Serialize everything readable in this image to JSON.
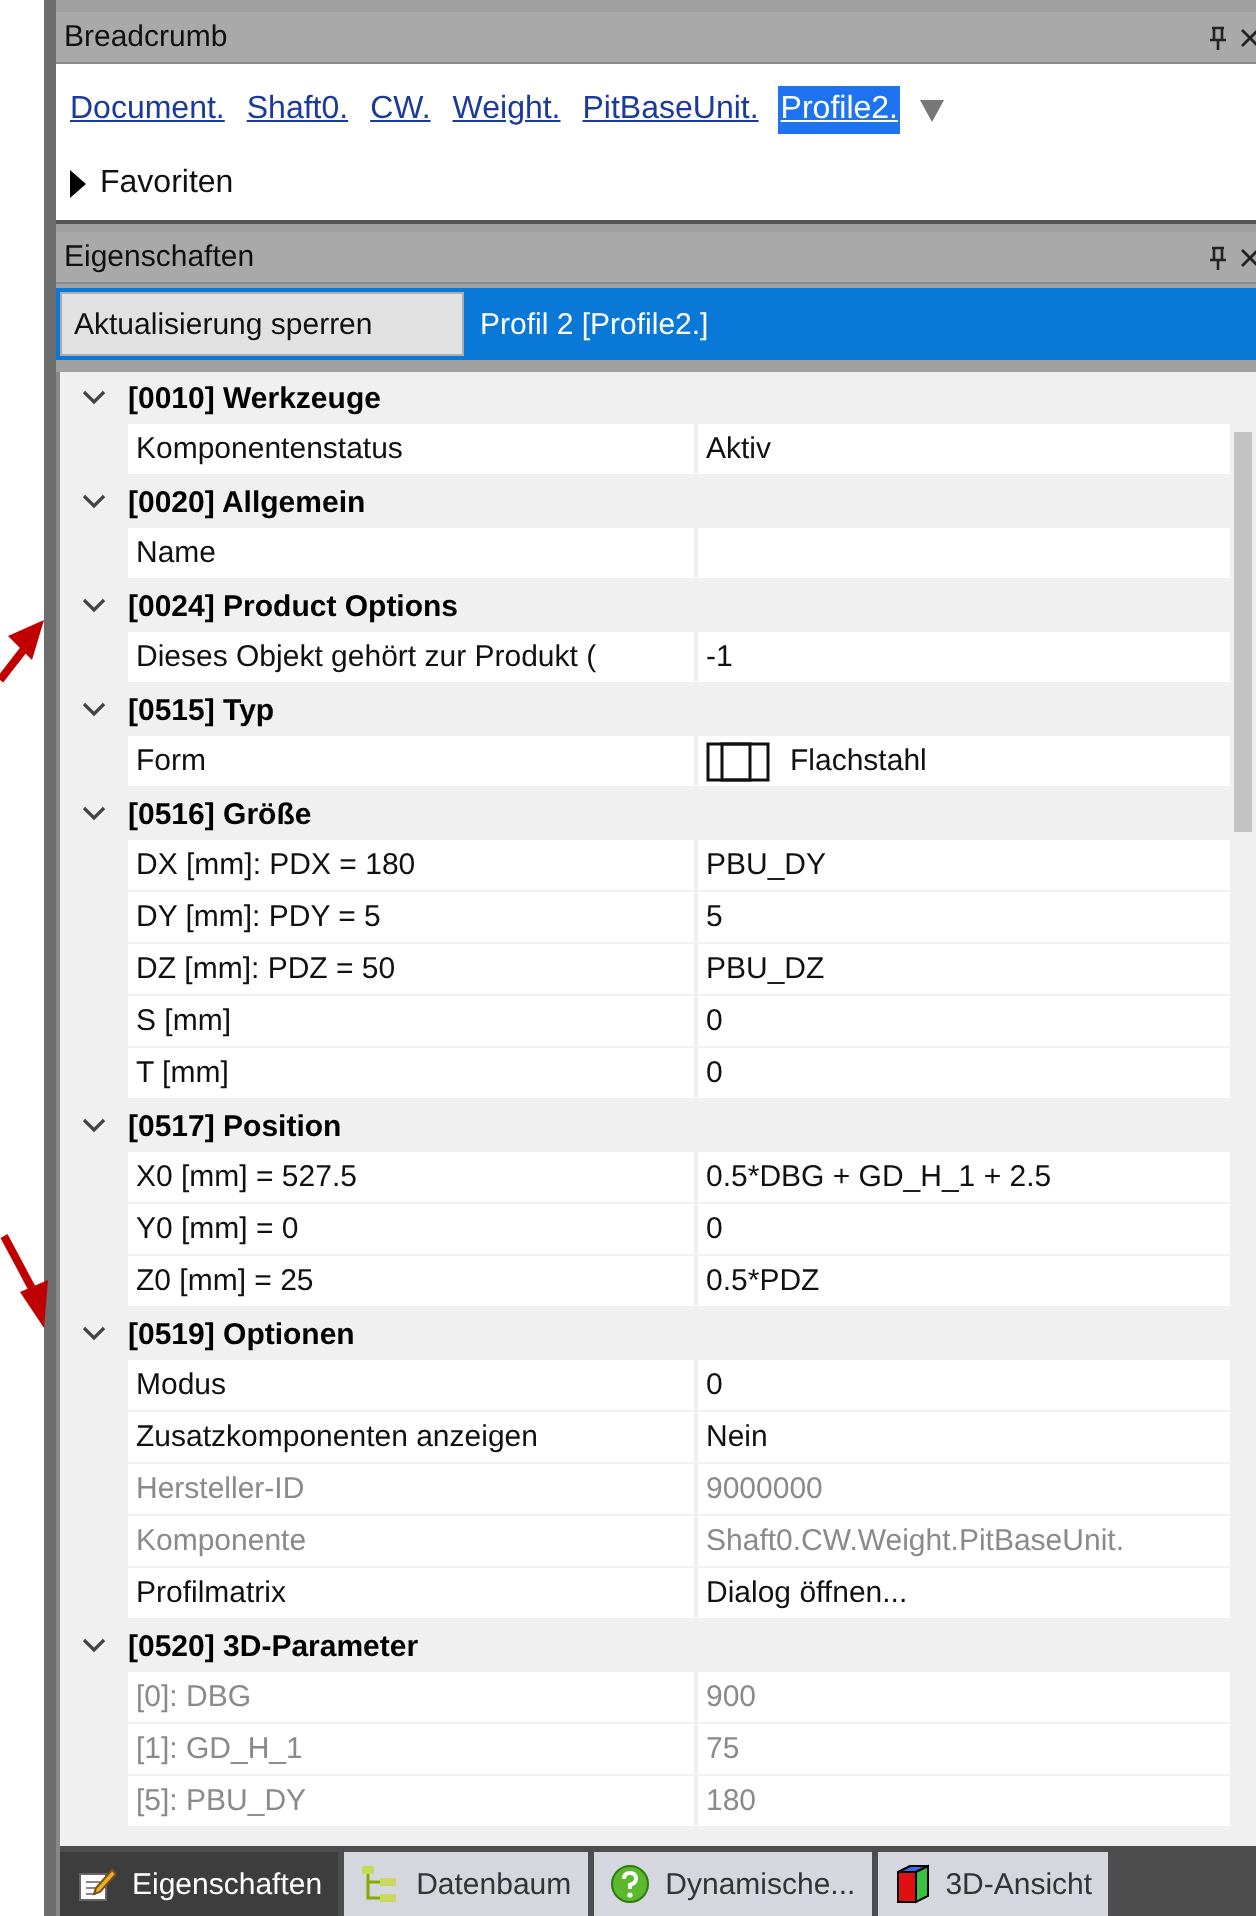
{
  "breadcrumb_panel": {
    "title": "Breadcrumb",
    "path": [
      {
        "label": "Document.",
        "selected": false
      },
      {
        "label": "Shaft0.",
        "selected": false
      },
      {
        "label": "CW.",
        "selected": false
      },
      {
        "label": "Weight.",
        "selected": false
      },
      {
        "label": "PitBaseUnit.",
        "selected": false
      },
      {
        "label": "Profile2.",
        "selected": true
      }
    ],
    "favorites": {
      "label": "Favoriten",
      "expanded": false
    }
  },
  "properties_panel": {
    "title": "Eigenschaften",
    "lock_button": "Aktualisierung sperren",
    "object_title": "Profil 2 [Profile2.]",
    "categories": [
      {
        "label": "[0010] Werkzeuge",
        "expanded": true,
        "rows": [
          {
            "name": "Komponentenstatus",
            "value": "Aktiv",
            "disabled": false
          }
        ]
      },
      {
        "label": "[0020] Allgemein",
        "expanded": true,
        "rows": [
          {
            "name": "Name",
            "disabled": false
          }
        ]
      },
      {
        "label": "[0024] Product Options",
        "expanded": true,
        "rows": [
          {
            "name": "Dieses Objekt gehört zur Produkt (",
            "value": "-1",
            "disabled": false
          }
        ]
      },
      {
        "label": "[0515] Typ",
        "expanded": true,
        "rows": [
          {
            "name": "Form",
            "value": "Flachstahl",
            "kind": "profile",
            "disabled": false
          }
        ]
      },
      {
        "label": "[0516] Größe",
        "expanded": true,
        "rows": [
          {
            "name": "DX [mm]: PDX = 180",
            "value": "PBU_DY",
            "disabled": false
          },
          {
            "name": "DY [mm]: PDY = 5",
            "value": "5",
            "disabled": false
          },
          {
            "name": "DZ [mm]: PDZ = 50",
            "value": "PBU_DZ",
            "disabled": false
          },
          {
            "name": "S [mm]",
            "value": "0",
            "disabled": false
          },
          {
            "name": "T [mm]",
            "value": "0",
            "disabled": false
          }
        ]
      },
      {
        "label": "[0517] Position",
        "expanded": true,
        "rows": [
          {
            "name": "X0 [mm] = 527.5",
            "value": "0.5*DBG + GD_H_1 + 2.5",
            "disabled": false
          },
          {
            "name": "Y0 [mm] = 0",
            "value": "0",
            "disabled": false
          },
          {
            "name": "Z0 [mm] = 25",
            "value": "0.5*PDZ",
            "disabled": false
          }
        ]
      },
      {
        "label": "[0519] Optionen",
        "expanded": true,
        "rows": [
          {
            "name": "Modus",
            "value": "0",
            "disabled": false
          },
          {
            "name": "Zusatzkomponenten anzeigen",
            "value": "Nein",
            "disabled": false
          },
          {
            "name": "Hersteller-ID",
            "value": "9000000",
            "disabled": true
          },
          {
            "name": "Komponente",
            "value": "Shaft0.CW.Weight.PitBaseUnit.",
            "disabled": true
          },
          {
            "name": "Profilmatrix",
            "value": "Dialog öffnen...",
            "disabled": false
          }
        ]
      },
      {
        "label": "[0520] 3D-Parameter",
        "expanded": true,
        "rows": [
          {
            "name": "[0]: DBG",
            "value": "900",
            "disabled": true
          },
          {
            "name": "[1]: GD_H_1",
            "value": "75",
            "disabled": true
          },
          {
            "name": "[5]: PBU_DY",
            "value": "180",
            "disabled": true
          }
        ]
      }
    ]
  },
  "bottom_tabs": [
    {
      "label": "Eigenschaften",
      "kind": "edit",
      "selected": true
    },
    {
      "label": "Datenbaum",
      "kind": "tree",
      "selected": false
    },
    {
      "label": "Dynamische...",
      "kind": "help",
      "selected": false
    },
    {
      "label": "3D-Ansicht",
      "kind": "cube",
      "selected": false
    }
  ]
}
